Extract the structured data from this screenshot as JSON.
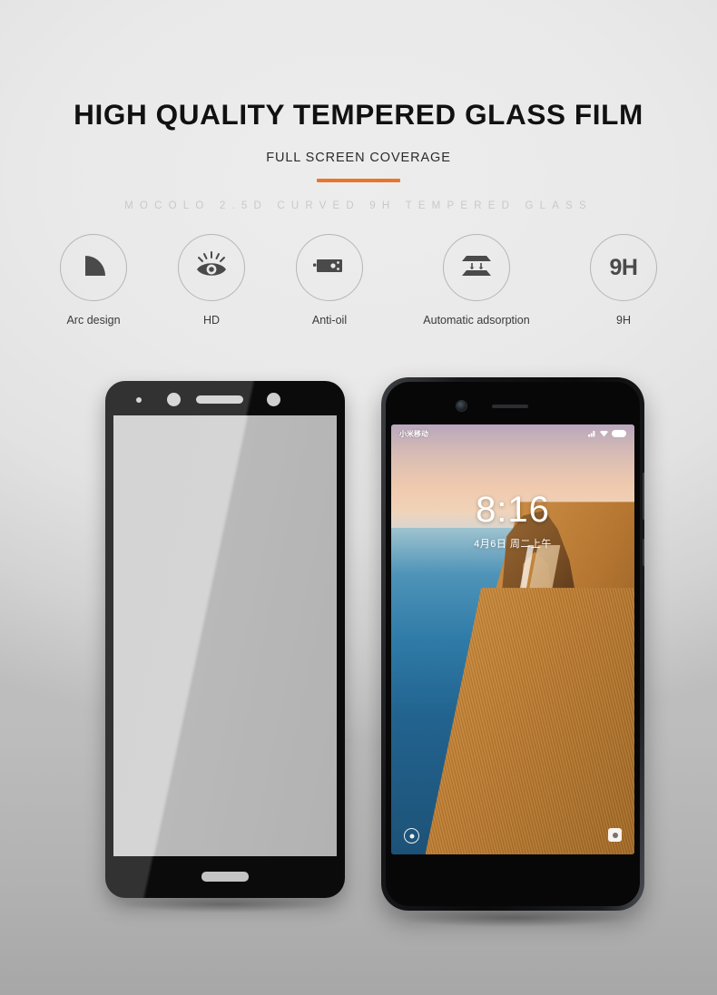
{
  "header": {
    "title": "HIGH QUALITY TEMPERED GLASS FILM",
    "subtitle": "FULL SCREEN COVERAGE",
    "tagline": "MOCOLO 2.5D CURVED 9H TEMPERED GLASS",
    "accent_color": "#e8762c"
  },
  "features": [
    {
      "label": "Arc design",
      "icon": "arc-quarter-circle-icon"
    },
    {
      "label": "HD",
      "icon": "eye-icon"
    },
    {
      "label": "Anti-oil",
      "icon": "oil-repel-icon"
    },
    {
      "label": "Automatic adsorption",
      "icon": "adsorption-plates-icon"
    },
    {
      "label": "9H",
      "icon": "hardness-9h-icon",
      "icon_text": "9H"
    }
  ],
  "glass_protector": {
    "name": "tempered-glass-screen-protector",
    "parts": [
      "sensor-dot",
      "proximity-sensor",
      "earpiece-slot",
      "front-camera-hole",
      "home-button-cutout"
    ]
  },
  "phone": {
    "status_bar": {
      "carrier": "小米移动",
      "icons": [
        "signal-icon",
        "wifi-icon",
        "battery-icon"
      ]
    },
    "lock_screen": {
      "time": "8:16",
      "date": "4月6日 周二上午",
      "left_action": "flashlight-icon",
      "right_action": "camera-icon"
    },
    "buttons": [
      "volume-rocker",
      "power-button"
    ]
  }
}
